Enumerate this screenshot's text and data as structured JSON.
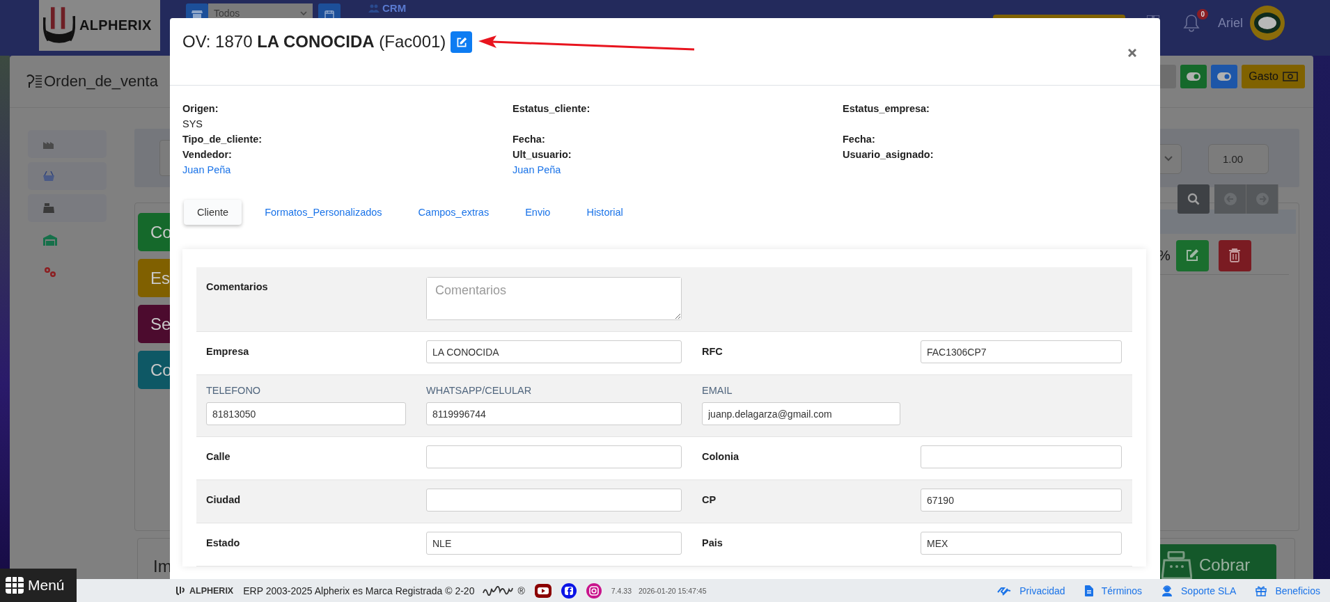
{
  "navbar": {
    "logo_text": "ALPHERIX",
    "store_filter": "Todos",
    "crm_link": "CRM",
    "notification_count": "0",
    "user_name": "Ariel"
  },
  "page": {
    "title": "Orden_de_venta",
    "expense_button": "Gasto",
    "quantity": "1.00",
    "discount_unit": "%",
    "summary_label": "Im",
    "charge_button": "Cobrar",
    "action_buttons": [
      {
        "label": "Co",
        "color": "#15692b"
      },
      {
        "label": "Es",
        "color": "#806000"
      },
      {
        "label": "Se",
        "color": "#4c0b2e"
      },
      {
        "label": "Co",
        "color": "#0e5865"
      }
    ]
  },
  "modal": {
    "title": "OV: 1870 **LA CONOCIDA** (Fac001)",
    "info_columns": [
      [
        {
          "label": "Origen:",
          "value": "SYS",
          "kind": "text"
        },
        {
          "label": "Tipo_de_cliente:"
        },
        {
          "label": "Vendedor:",
          "value": "Juan Peña",
          "kind": "link"
        }
      ],
      [
        {
          "label": "Estatus_cliente:"
        },
        {
          "label": "Fecha:"
        },
        {
          "label": "Ult_usuario:",
          "value": "Juan Peña",
          "kind": "link"
        }
      ],
      [
        {
          "label": "Estatus_empresa:"
        },
        {
          "label": "Fecha:"
        },
        {
          "label": "Usuario_asignado:"
        }
      ]
    ],
    "tabs": [
      {
        "label": "Cliente",
        "selected": true
      },
      {
        "label": "Formatos_Personalizados",
        "selected": false
      },
      {
        "label": "Campos_extras",
        "selected": false
      },
      {
        "label": "Envio",
        "selected": false
      },
      {
        "label": "Historial",
        "selected": false
      }
    ],
    "form_rows": [
      {
        "kind": "pairs",
        "items": [
          {
            "label": "Comentarios",
            "kind": "textarea",
            "placeholder": "Comentarios"
          }
        ]
      },
      {
        "kind": "pairs",
        "items": [
          {
            "label": "Empresa",
            "kind": "input",
            "value": "LA CONOCIDA"
          },
          {
            "label": "RFC",
            "kind": "input",
            "value": "FAC1306CP7"
          }
        ]
      },
      {
        "kind": "stacked",
        "items": [
          {
            "label": "TELEFONO",
            "kind": "input",
            "value": "81813050"
          },
          {
            "label": "WHATSAPP/CELULAR",
            "kind": "input",
            "value": "8119996744"
          },
          {
            "label": "EMAIL",
            "kind": "input",
            "value": "juanp.delagarza@gmail.com"
          }
        ]
      },
      {
        "kind": "pairs",
        "items": [
          {
            "label": "Calle",
            "kind": "input"
          },
          {
            "label": "Colonia",
            "kind": "input"
          }
        ]
      },
      {
        "kind": "pairs",
        "items": [
          {
            "label": "Ciudad",
            "kind": "input"
          },
          {
            "label": "CP",
            "kind": "input",
            "value": "67190"
          }
        ]
      },
      {
        "kind": "pairs",
        "items": [
          {
            "label": "Estado",
            "kind": "input",
            "value": "NLE"
          },
          {
            "label": "Pais",
            "kind": "input",
            "value": "MEX"
          }
        ]
      }
    ]
  },
  "footer": {
    "logo_text": "ALPHERIX",
    "copyright": "ERP 2003-2025 Alpherix es Marca Registrada © 2-20",
    "registered": "®",
    "version": "7.4.33",
    "timestamp": "2026-01-20 15:47:45",
    "links": [
      "Privacidad",
      "Términos",
      "Soporte SLA",
      "Beneficios"
    ]
  },
  "menu_button": "Menú"
}
